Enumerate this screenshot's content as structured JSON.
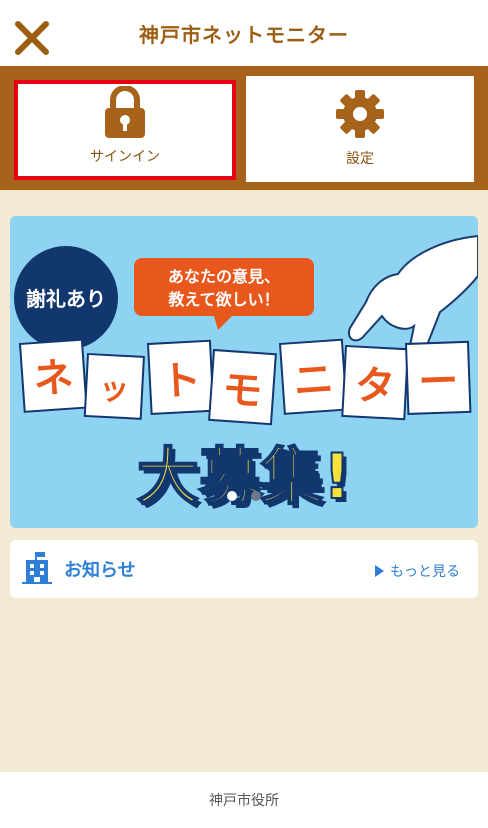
{
  "header": {
    "title": "神戸市ネットモニター",
    "close_icon": "close-icon"
  },
  "menu": {
    "signin_label": "サインイン",
    "settings_label": "設定"
  },
  "banner": {
    "badge": "謝礼あり",
    "bubble_line1": "あなたの意見、",
    "bubble_line2": "教えて欲しい！",
    "cards": [
      "ネ",
      "ッ",
      "ト",
      "モ",
      "ニ",
      "タ",
      "ー"
    ],
    "headline": "大募集!",
    "slide_count": 2,
    "active_slide": 1
  },
  "info": {
    "title": "お知らせ",
    "more_label": "もっと見る"
  },
  "footer": {
    "text": "神戸市役所"
  },
  "colors": {
    "brand_brown": "#a8631b",
    "accent_blue": "#2f7fd6",
    "highlight_red": "#e60012",
    "banner_orange": "#e8581c"
  }
}
